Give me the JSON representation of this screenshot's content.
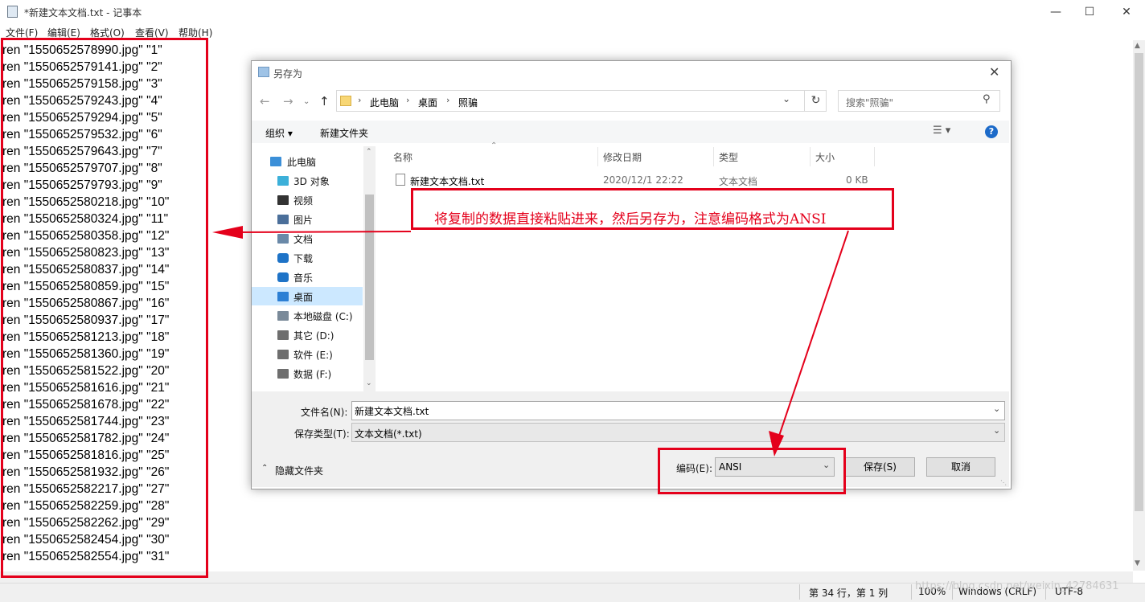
{
  "notepad": {
    "title": "*新建文本文档.txt - 记事本",
    "menu": [
      "文件(F)",
      "编辑(E)",
      "格式(O)",
      "查看(V)",
      "帮助(H)"
    ],
    "lines": [
      "ren \"1550652578990.jpg\" \"1\"",
      "ren \"1550652579141.jpg\" \"2\"",
      "ren \"1550652579158.jpg\" \"3\"",
      "ren \"1550652579243.jpg\" \"4\"",
      "ren \"1550652579294.jpg\" \"5\"",
      "ren \"1550652579532.jpg\" \"6\"",
      "ren \"1550652579643.jpg\" \"7\"",
      "ren \"1550652579707.jpg\" \"8\"",
      "ren \"1550652579793.jpg\" \"9\"",
      "ren \"1550652580218.jpg\" \"10\"",
      "ren \"1550652580324.jpg\" \"11\"",
      "ren \"1550652580358.jpg\" \"12\"",
      "ren \"1550652580823.jpg\" \"13\"",
      "ren \"1550652580837.jpg\" \"14\"",
      "ren \"1550652580859.jpg\" \"15\"",
      "ren \"1550652580867.jpg\" \"16\"",
      "ren \"1550652580937.jpg\" \"17\"",
      "ren \"1550652581213.jpg\" \"18\"",
      "ren \"1550652581360.jpg\" \"19\"",
      "ren \"1550652581522.jpg\" \"20\"",
      "ren \"1550652581616.jpg\" \"21\"",
      "ren \"1550652581678.jpg\" \"22\"",
      "ren \"1550652581744.jpg\" \"23\"",
      "ren \"1550652581782.jpg\" \"24\"",
      "ren \"1550652581816.jpg\" \"25\"",
      "ren \"1550652581932.jpg\" \"26\"",
      "ren \"1550652582217.jpg\" \"27\"",
      "ren \"1550652582259.jpg\" \"28\"",
      "ren \"1550652582262.jpg\" \"29\"",
      "ren \"1550652582454.jpg\" \"30\"",
      "ren \"1550652582554.jpg\" \"31\""
    ],
    "status": {
      "position": "第 34 行，第 1 列",
      "zoom": "100%",
      "line_ending": "Windows (CRLF)",
      "encoding": "UTF-8"
    }
  },
  "dialog": {
    "title": "另存为",
    "breadcrumb": [
      "此电脑",
      "桌面",
      "照骗"
    ],
    "search_placeholder": "搜索\"照骗\"",
    "toolbar": {
      "organize": "组织 ▾",
      "new_folder": "新建文件夹"
    },
    "nav_items": [
      {
        "label": "此电脑",
        "icon": "computer-icon"
      },
      {
        "label": "3D 对象",
        "icon": "cube-icon"
      },
      {
        "label": "视频",
        "icon": "video-icon"
      },
      {
        "label": "图片",
        "icon": "picture-icon"
      },
      {
        "label": "文档",
        "icon": "document-icon"
      },
      {
        "label": "下载",
        "icon": "download-icon"
      },
      {
        "label": "音乐",
        "icon": "music-icon"
      },
      {
        "label": "桌面",
        "icon": "desktop-icon"
      },
      {
        "label": "本地磁盘 (C:)",
        "icon": "drive-icon"
      },
      {
        "label": "其它 (D:)",
        "icon": "drive-icon"
      },
      {
        "label": "软件 (E:)",
        "icon": "drive-icon"
      },
      {
        "label": "数据 (F:)",
        "icon": "drive-icon"
      }
    ],
    "columns": [
      "名称",
      "修改日期",
      "类型",
      "大小"
    ],
    "files": [
      {
        "name": "新建文本文档.txt",
        "date": "2020/12/1 22:22",
        "type": "文本文档",
        "size": "0 KB"
      }
    ],
    "filename_label": "文件名(N):",
    "filename_value": "新建文本文档.txt",
    "filetype_label": "保存类型(T):",
    "filetype_value": "文本文档(*.txt)",
    "hide_folders": "隐藏文件夹",
    "encoding_label": "编码(E):",
    "encoding_value": "ANSI",
    "save": "保存(S)",
    "cancel": "取消"
  },
  "annotation": {
    "text": "将复制的数据直接粘贴进来，然后另存为，注意编码格式为ANSI",
    "color": "#e4001b"
  },
  "watermark": "https://blog.csdn.net/weixin_42784631"
}
